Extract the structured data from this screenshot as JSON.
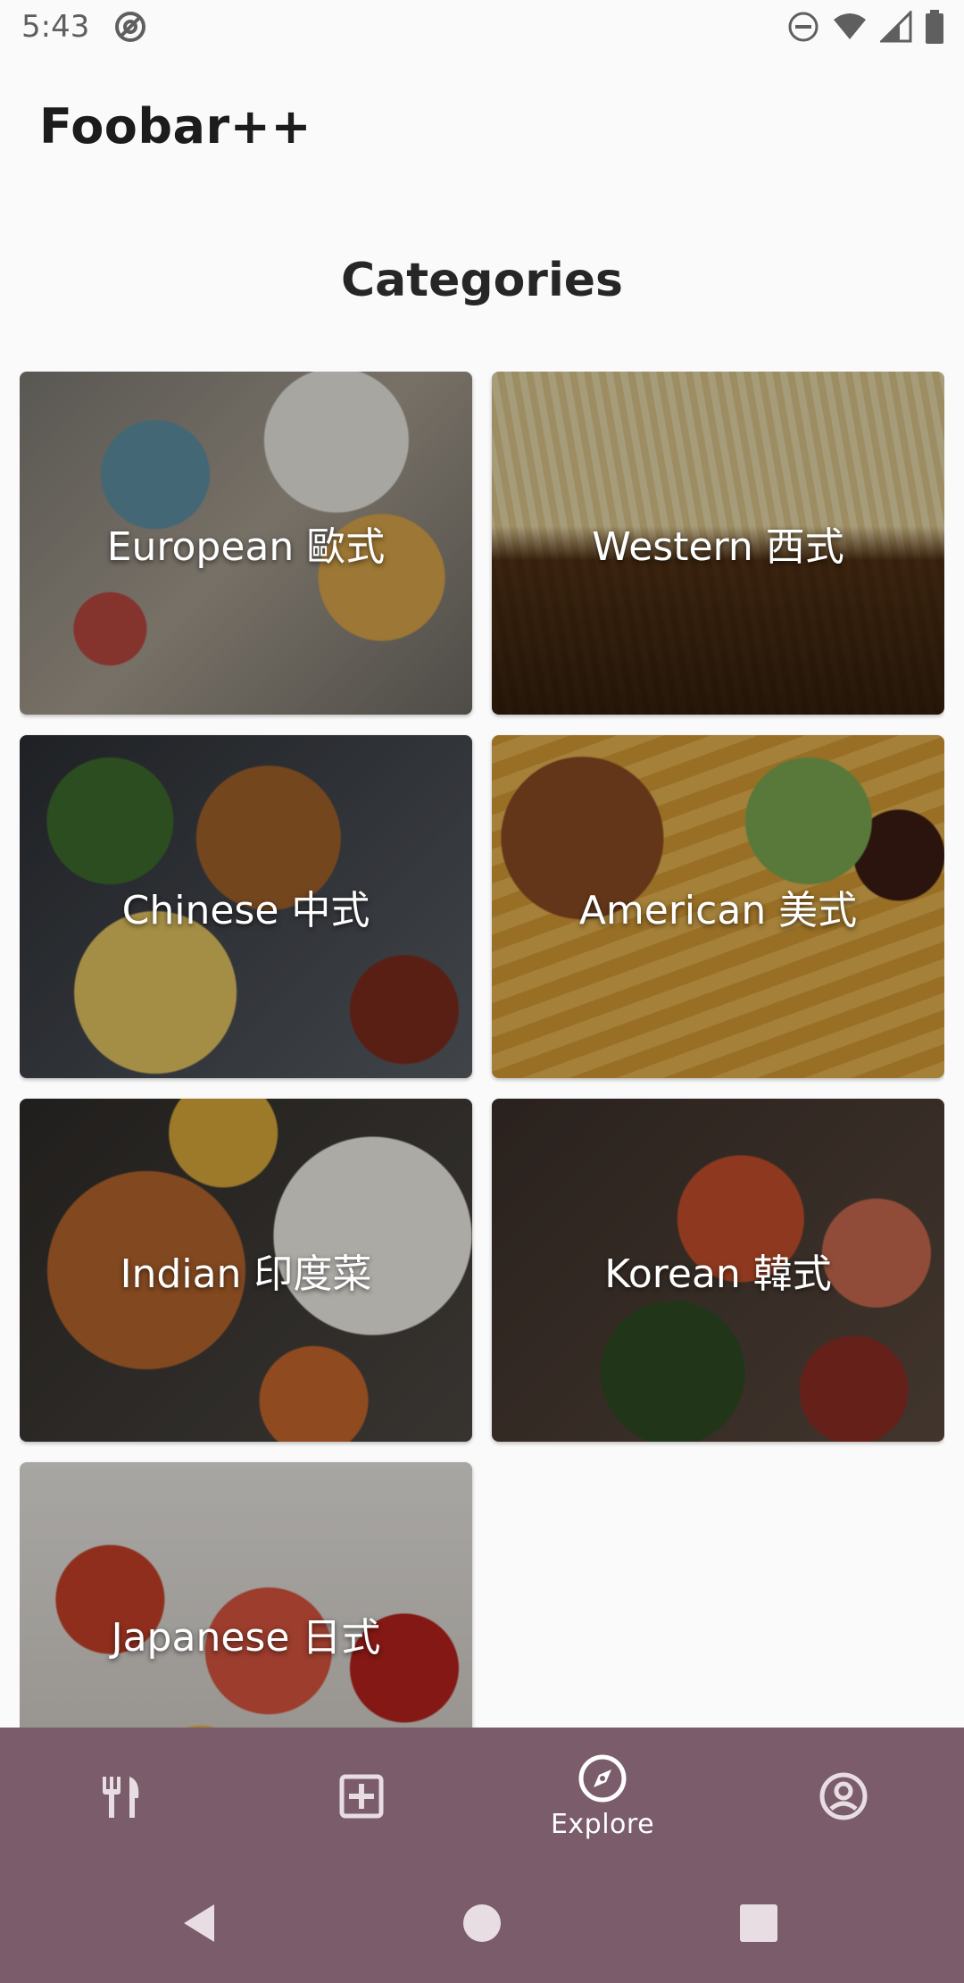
{
  "status_bar": {
    "time": "5:43"
  },
  "app": {
    "title": "Foobar++"
  },
  "section": {
    "title": "Categories"
  },
  "categories": [
    {
      "label": "European 歐式"
    },
    {
      "label": "Western 西式"
    },
    {
      "label": "Chinese 中式"
    },
    {
      "label": "American 美式"
    },
    {
      "label": "Indian 印度菜"
    },
    {
      "label": "Korean 韓式"
    },
    {
      "label": "Japanese 日式"
    }
  ],
  "bottom_nav": {
    "items": [
      {
        "icon": "restaurant-icon",
        "label": ""
      },
      {
        "icon": "add-box-icon",
        "label": ""
      },
      {
        "icon": "compass-icon",
        "label": "Explore"
      },
      {
        "icon": "account-icon",
        "label": ""
      }
    ],
    "background": "#7a5c6a"
  }
}
